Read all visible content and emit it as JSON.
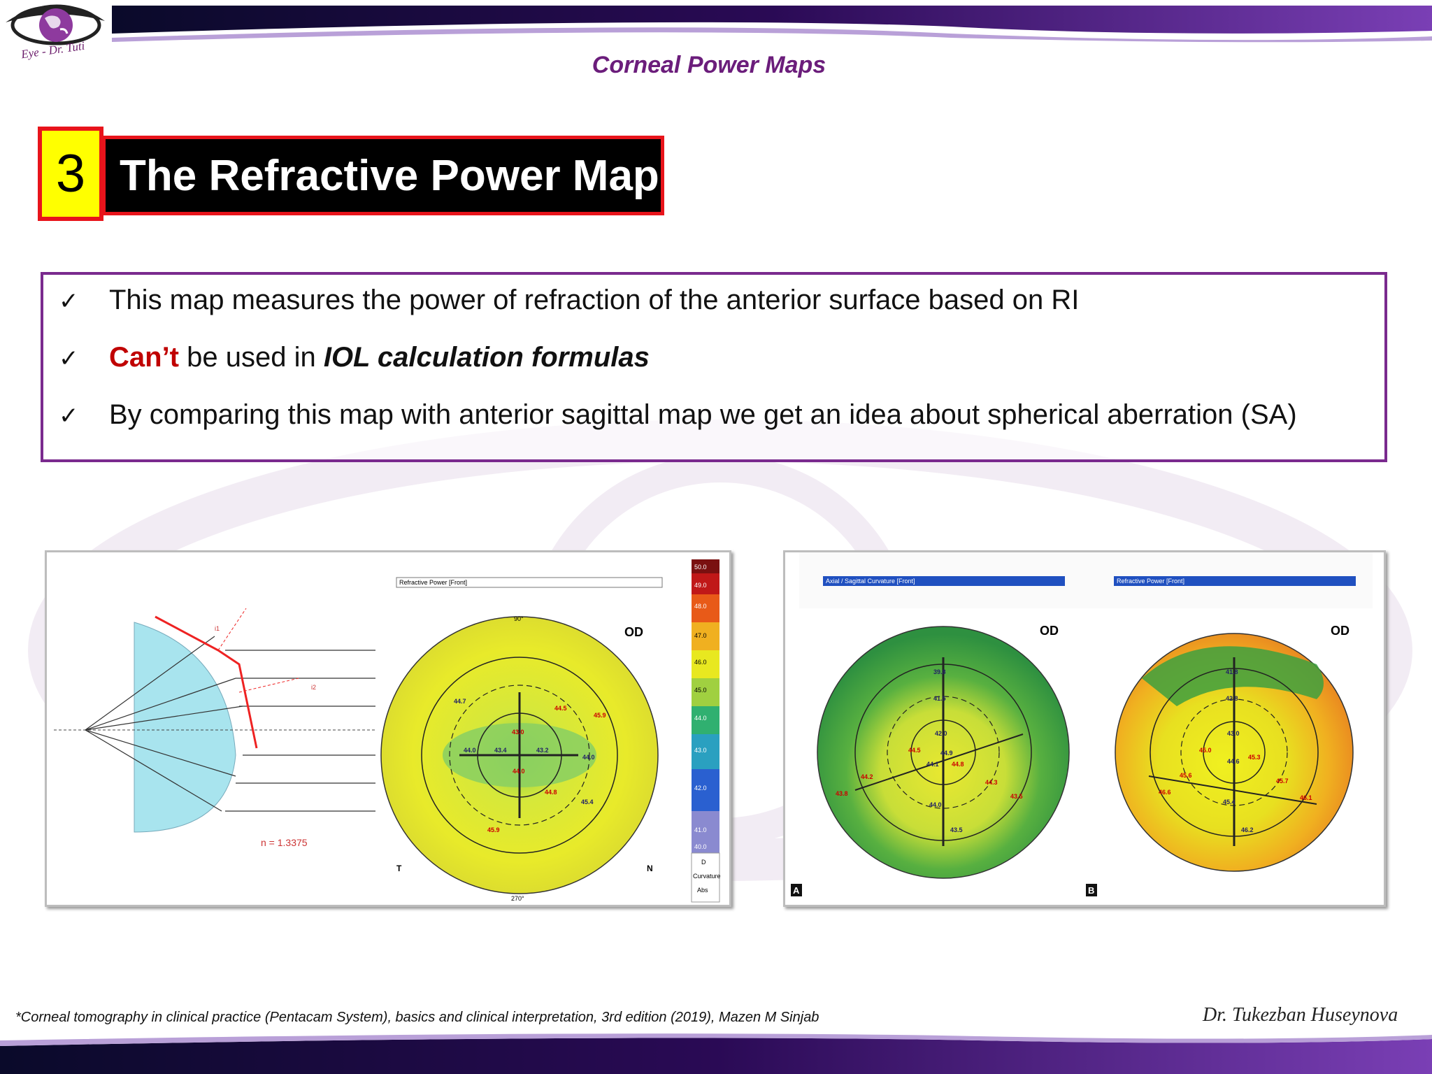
{
  "header": {
    "logo_text": "Eye - Dr. Tuti",
    "title": "Corneal Power Maps"
  },
  "section": {
    "number": "3",
    "title": "The Refractive Power Map"
  },
  "bullets": [
    {
      "check": "✓",
      "text": "This map measures the power of refraction of the anterior surface based on RI"
    },
    {
      "check": "✓",
      "red": "Can’t",
      "middle": " be used in ",
      "bold_italic": "IOL calculation formulas"
    },
    {
      "check": "✓",
      "text": "By comparing this map with anterior sagittal map we get an idea about spherical aberration (SA)"
    }
  ],
  "figure_left": {
    "dropdown": "Refractive Power [Front]",
    "eye": "OD",
    "n_label": "n = 1.3375",
    "i1": "i1",
    "i2": "i2",
    "axis_T": "T",
    "axis_N": "N",
    "deg_90": "90°",
    "deg_270": "270°",
    "values": [
      "43.0",
      "44.5",
      "45.9",
      "44.7",
      "44.0",
      "43.4",
      "43.2",
      "44.0",
      "44.0",
      "44.8",
      "45.4",
      "45.9"
    ],
    "scale_labels": [
      "50.0",
      "49.0",
      "48.0",
      "47.0",
      "46.0",
      "45.0",
      "44.0",
      "43.0",
      "42.0",
      "41.0",
      "40.0"
    ],
    "scale_bottom": [
      "D",
      "Curvature",
      "Abs"
    ]
  },
  "figure_right": {
    "dropdown_a": "Axial / Sagittal Curvature [Front]",
    "dropdown_b": "Refractive Power [Front]",
    "eye_a": "OD",
    "eye_b": "OD",
    "label_a": "A",
    "label_b": "B",
    "values_a": [
      "39.8",
      "41.5",
      "42.0",
      "44.5",
      "44.9",
      "44.1",
      "44.8",
      "44.2",
      "43.8",
      "44.0",
      "44.3",
      "43.5",
      "43.5"
    ],
    "values_b": [
      "41.8",
      "42.8",
      "43.0",
      "45.0",
      "44.6",
      "45.3",
      "45.6",
      "46.6",
      "45.4",
      "45.7",
      "46.1",
      "46.2"
    ]
  },
  "footer": {
    "reference": "*Corneal tomography in clinical practice (Pentacam System), basics and clinical interpretation, 3rd edition (2019), Mazen M Sinjab",
    "author": "Dr. Tukezban Huseynova"
  },
  "colors": {
    "accent_purple": "#6b1d7b",
    "title_red": "#e8141b",
    "number_yellow": "#ffff00",
    "cant_red": "#c00000"
  }
}
